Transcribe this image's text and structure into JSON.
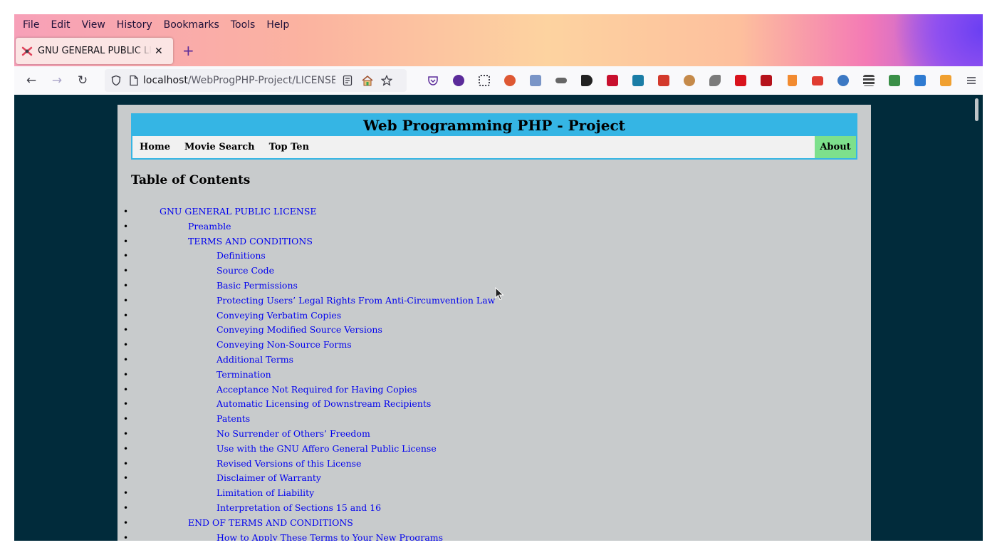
{
  "menubar": {
    "items": [
      "File",
      "Edit",
      "View",
      "History",
      "Bookmarks",
      "Tools",
      "Help"
    ]
  },
  "tab": {
    "title": "GNU GENERAL PUBLIC LICENSE",
    "close": "✕"
  },
  "newtab": "+",
  "navbar": {
    "back": "←",
    "forward": "→",
    "reload": "↻",
    "url_host": "localhost",
    "url_path": "/WebProgPHP-Project/LICENSE.html"
  },
  "extensions": [
    {
      "name": "pocket-icon",
      "color": "#ef4056"
    },
    {
      "name": "tor-icon",
      "color": "#5b2b9a"
    },
    {
      "name": "share-icon",
      "color": "#3c3c46"
    },
    {
      "name": "duckduckgo-icon",
      "color": "#de5833"
    },
    {
      "name": "copy-icon",
      "color": "#7a95c7"
    },
    {
      "name": "stylus-icon",
      "color": "#555555"
    },
    {
      "name": "d-icon",
      "color": "#222222"
    },
    {
      "name": "wand-icon",
      "color": "#c8102e"
    },
    {
      "name": "a-icon",
      "color": "#1b7da6"
    },
    {
      "name": "pdf-icon",
      "color": "#d33a2c"
    },
    {
      "name": "palette-icon",
      "color": "#c58a4a"
    },
    {
      "name": "feather-icon",
      "color": "#6b6b6b"
    },
    {
      "name": "n-icon",
      "color": "#d9131c"
    },
    {
      "name": "record-icon",
      "color": "#b5121b"
    },
    {
      "name": "trash-icon",
      "color": "#f28b30"
    },
    {
      "name": "camera-icon",
      "color": "#e03c31"
    },
    {
      "name": "glasses-icon",
      "color": "#3c78c3"
    },
    {
      "name": "stack-icon",
      "color": "#444444"
    },
    {
      "name": "edit-icon",
      "color": "#3a8f47"
    },
    {
      "name": "lock-icon",
      "color": "#2f7bd1"
    },
    {
      "name": "puzzle-icon",
      "color": "#f0a030"
    }
  ],
  "site": {
    "title": "Web Programming PHP - Project",
    "nav": [
      "Home",
      "Movie Search",
      "Top Ten"
    ],
    "about": "About"
  },
  "toc": {
    "heading": "Table of Contents",
    "items": [
      {
        "level": 1,
        "text": "GNU GENERAL PUBLIC LICENSE"
      },
      {
        "level": 2,
        "text": "Preamble"
      },
      {
        "level": 2,
        "text": "TERMS AND CONDITIONS"
      },
      {
        "level": 3,
        "text": "Definitions"
      },
      {
        "level": 3,
        "text": "Source Code"
      },
      {
        "level": 3,
        "text": "Basic Permissions"
      },
      {
        "level": 3,
        "text": "Protecting Users’ Legal Rights From Anti-Circumvention Law"
      },
      {
        "level": 3,
        "text": "Conveying Verbatim Copies"
      },
      {
        "level": 3,
        "text": "Conveying Modified Source Versions"
      },
      {
        "level": 3,
        "text": "Conveying Non-Source Forms"
      },
      {
        "level": 3,
        "text": "Additional Terms"
      },
      {
        "level": 3,
        "text": "Termination"
      },
      {
        "level": 3,
        "text": "Acceptance Not Required for Having Copies"
      },
      {
        "level": 3,
        "text": "Automatic Licensing of Downstream Recipients"
      },
      {
        "level": 3,
        "text": "Patents"
      },
      {
        "level": 3,
        "text": "No Surrender of Others’ Freedom"
      },
      {
        "level": 3,
        "text": "Use with the GNU Affero General Public License"
      },
      {
        "level": 3,
        "text": "Revised Versions of this License"
      },
      {
        "level": 3,
        "text": "Disclaimer of Warranty"
      },
      {
        "level": 3,
        "text": "Limitation of Liability"
      },
      {
        "level": 3,
        "text": "Interpretation of Sections 15 and 16"
      },
      {
        "level": 2,
        "text": "END OF TERMS AND CONDITIONS"
      },
      {
        "level": 3,
        "text": "How to Apply These Terms to Your New Programs"
      }
    ]
  }
}
